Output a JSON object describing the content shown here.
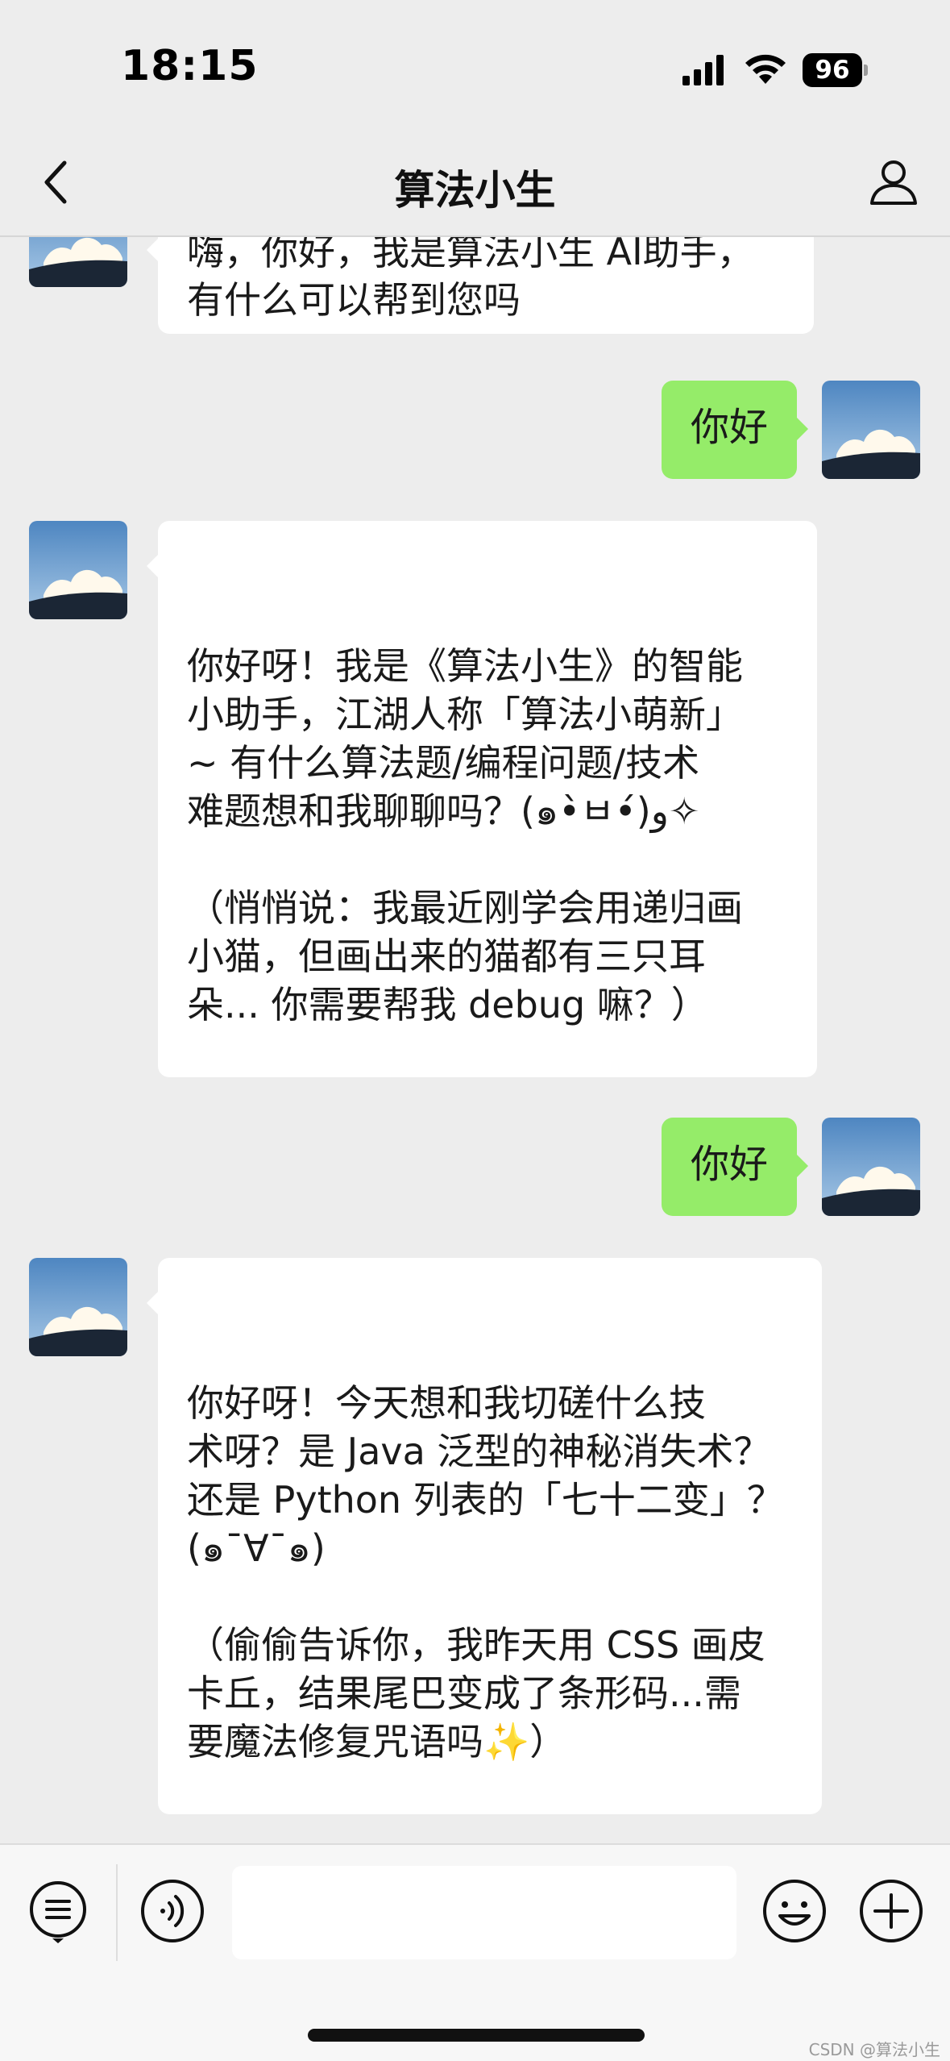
{
  "status_bar": {
    "time": "18:15",
    "battery_level": "96",
    "icons": [
      "signal-icon",
      "wifi-icon",
      "battery-icon"
    ]
  },
  "nav": {
    "title": "算法小生",
    "back_icon": "chevron-left-icon",
    "profile_icon": "person-icon"
  },
  "messages": [
    {
      "sender": "bot",
      "text": "嗨，你好，我是算法小生 AI助手，\n有什么可以帮到您吗"
    },
    {
      "sender": "user",
      "text": "你好"
    },
    {
      "sender": "bot",
      "text": "你好呀！我是《算法小生》的智能\n小助手，江湖人称「算法小萌新」\n~ 有什么算法题/编程问题/技术\n难题想和我聊聊吗？(๑•̀ㅂ•́)و✧\n\n（悄悄说：我最近刚学会用递归画\n小猫，但画出来的猫都有三只耳\n朵... 你需要帮我 debug 嘛？）"
    },
    {
      "sender": "user",
      "text": "你好"
    },
    {
      "sender": "bot",
      "text": "你好呀！今天想和我切磋什么技\n术呀？是 Java 泛型的神秘消失术？\n还是 Python 列表的「七十二变」？\n(๑¯∀¯๑)\n\n（偷偷告诉你，我昨天用 CSS 画皮\n卡丘，结果尾巴变成了条形码...需\n要魔法修复咒语吗✨）"
    }
  ],
  "input_bar": {
    "menu_icon": "menu-list-icon",
    "voice_icon": "voice-icon",
    "emoji_icon": "emoji-icon",
    "plus_icon": "plus-icon",
    "input_value": ""
  },
  "colors": {
    "background": "#ededed",
    "incoming_bubble": "#ffffff",
    "outgoing_bubble": "#95ec69"
  },
  "watermark": "CSDN @算法小生"
}
